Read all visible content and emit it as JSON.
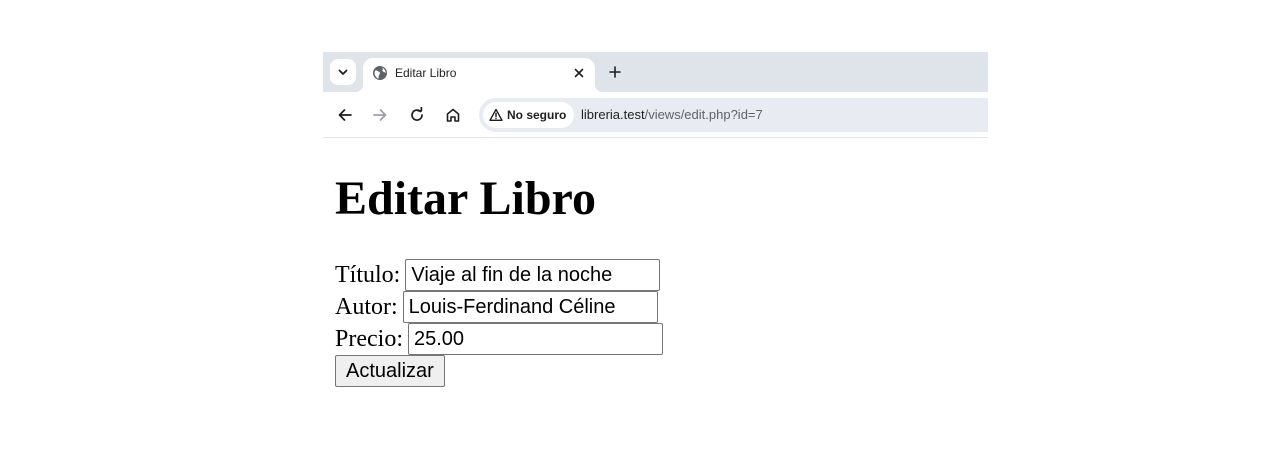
{
  "browser": {
    "tab": {
      "title": "Editar Libro",
      "favicon": "globe-icon"
    },
    "toolbar": {
      "security_label": "No seguro",
      "url_host": "libreria.test",
      "url_path": "/views/edit.php?id=7"
    }
  },
  "page": {
    "heading": "Editar Libro",
    "form": {
      "fields": [
        {
          "label": "Título:",
          "value": "Viaje al fin de la noche"
        },
        {
          "label": "Autor:",
          "value": "Louis-Ferdinand Céline"
        },
        {
          "label": "Precio:",
          "value": "25.00"
        }
      ],
      "submit_label": "Actualizar"
    }
  }
}
